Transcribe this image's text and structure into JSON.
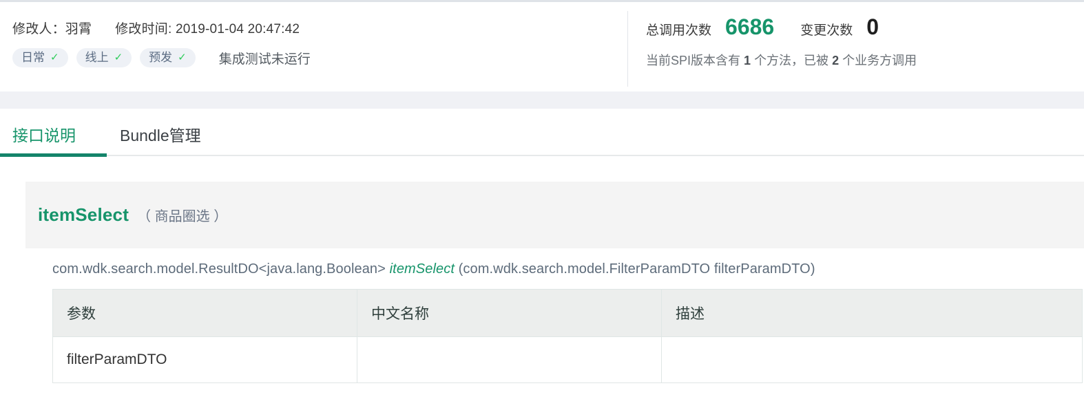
{
  "header": {
    "editor_label": "修改人：羽霄",
    "modified_label": "修改时间: 2019-01-04 20:47:42",
    "env_badges": [
      {
        "label": "日常",
        "tick": "✓"
      },
      {
        "label": "线上",
        "tick": "✓"
      },
      {
        "label": "预发",
        "tick": "✓"
      }
    ],
    "integration_test_status": "集成测试未运行",
    "stats": [
      {
        "label": "总调用次数",
        "value": "6686",
        "color": "#16946a"
      },
      {
        "label": "变更次数",
        "value": "0",
        "color": "#1f1f1f"
      }
    ],
    "spi_note_parts": {
      "p1": "当前SPI版本含有",
      "n1": "1",
      "p2": "个方法，已被",
      "n2": "2",
      "p3": "个业务方调用"
    }
  },
  "tabs": [
    {
      "label": "接口说明",
      "active": true
    },
    {
      "label": "Bundle管理",
      "active": false
    }
  ],
  "method": {
    "name": "itemSelect",
    "chinese_name": "（ 商品圈选 ）",
    "signature": {
      "return_type": "com.wdk.search.model.ResultDO<java.lang.Boolean>",
      "method_name": "itemSelect",
      "params": "(com.wdk.search.model.FilterParamDTO filterParamDTO)"
    }
  },
  "param_table": {
    "columns": [
      "参数",
      "中文名称",
      "描述"
    ],
    "rows": [
      {
        "param": "filterParamDTO",
        "chinese_name": "",
        "description": ""
      }
    ]
  }
}
